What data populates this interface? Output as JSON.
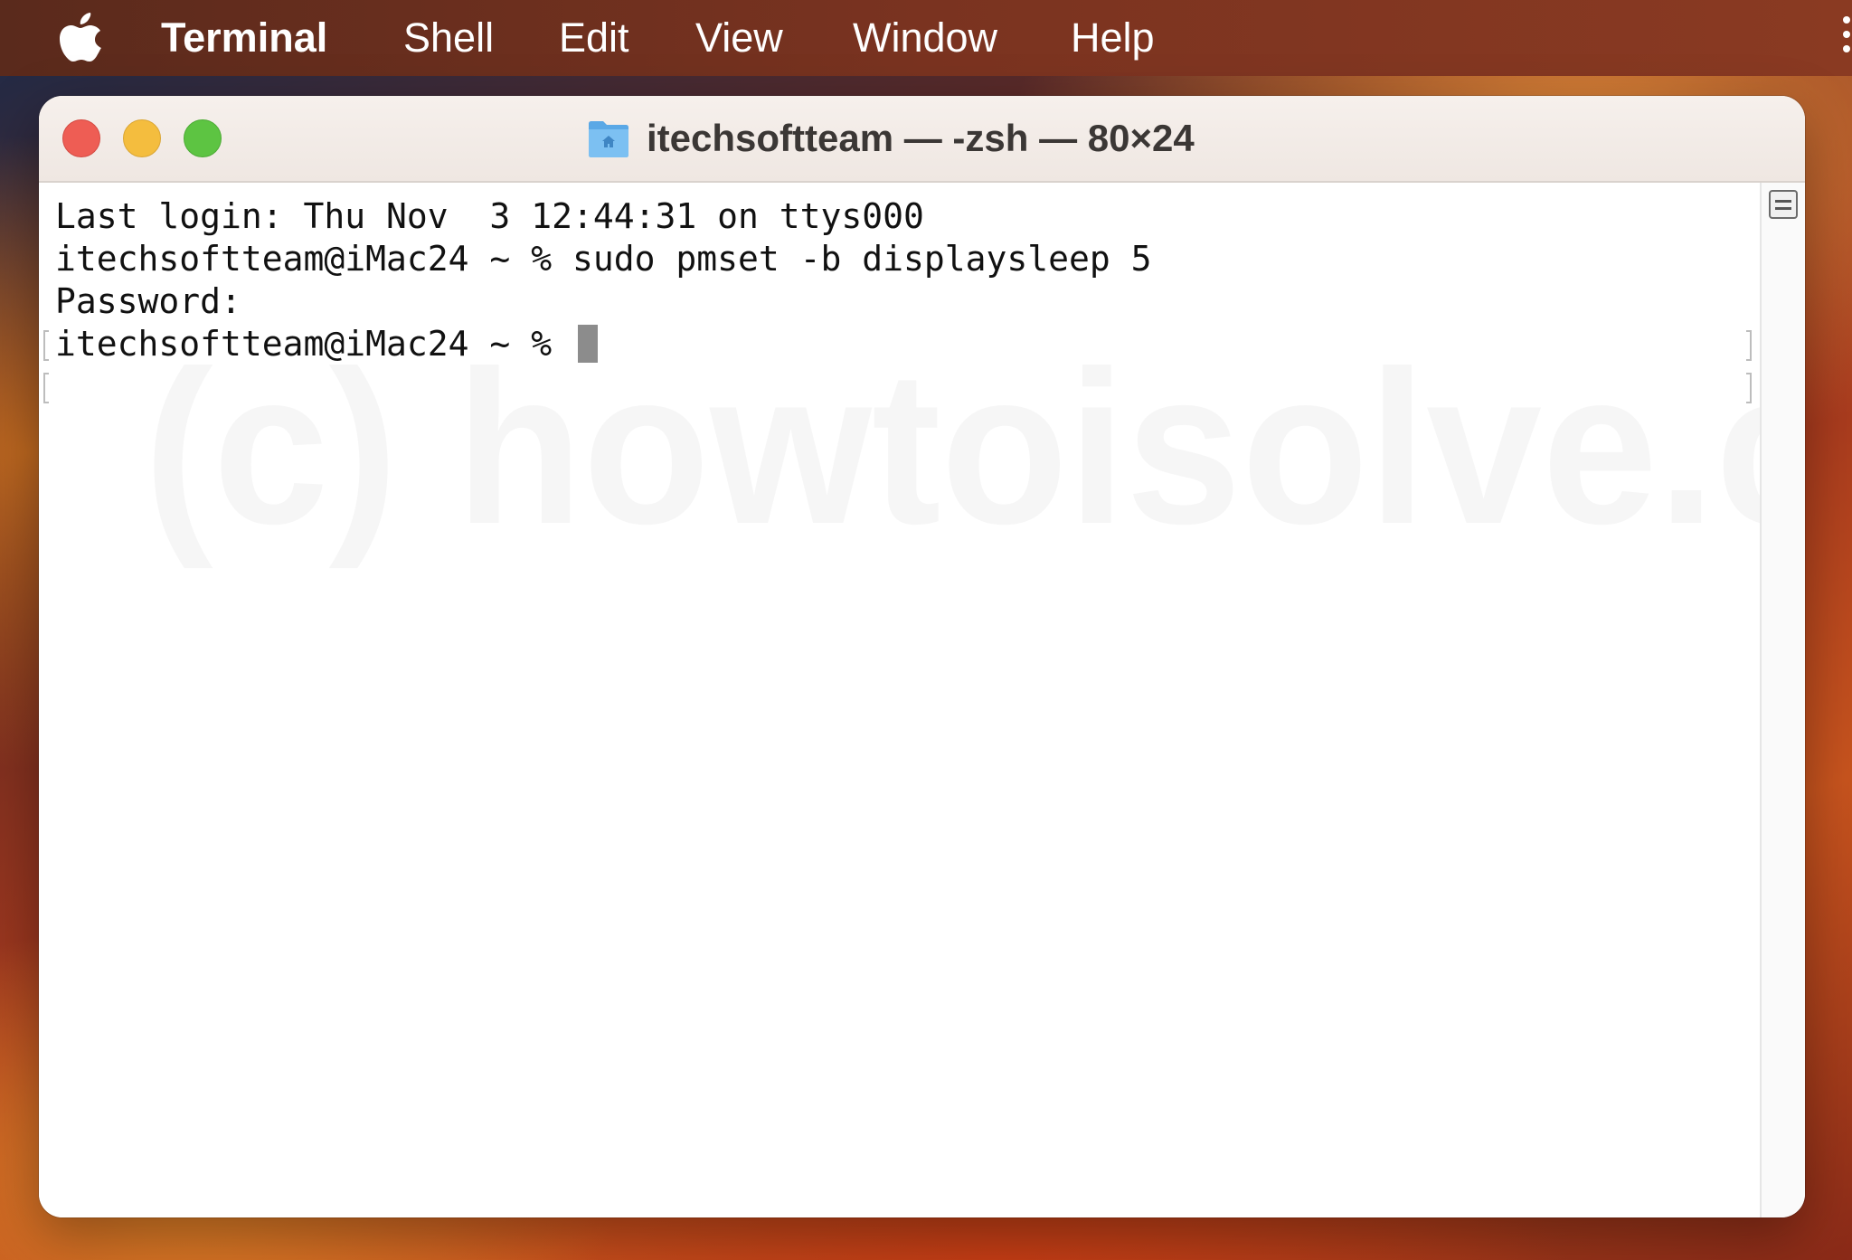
{
  "menubar": {
    "apple_icon": "apple-logo-icon",
    "app_name": "Terminal",
    "items": [
      "Shell",
      "Edit",
      "View",
      "Window",
      "Help"
    ]
  },
  "window": {
    "title": "itechsoftteam — -zsh — 80×24",
    "folder_icon": "home-folder-icon"
  },
  "terminal": {
    "lines": [
      "Last login: Thu Nov  3 12:44:31 on ttys000",
      "itechsoftteam@iMac24 ~ % sudo pmset -b displaysleep 5",
      "Password:",
      "itechsoftteam@iMac24 ~ % "
    ]
  },
  "watermark": "(c) howtoisolve.com",
  "colors": {
    "close": "#ee5d54",
    "minimize": "#f4bd3e",
    "zoom": "#5dc442",
    "cursor": "#8c8c8c"
  }
}
